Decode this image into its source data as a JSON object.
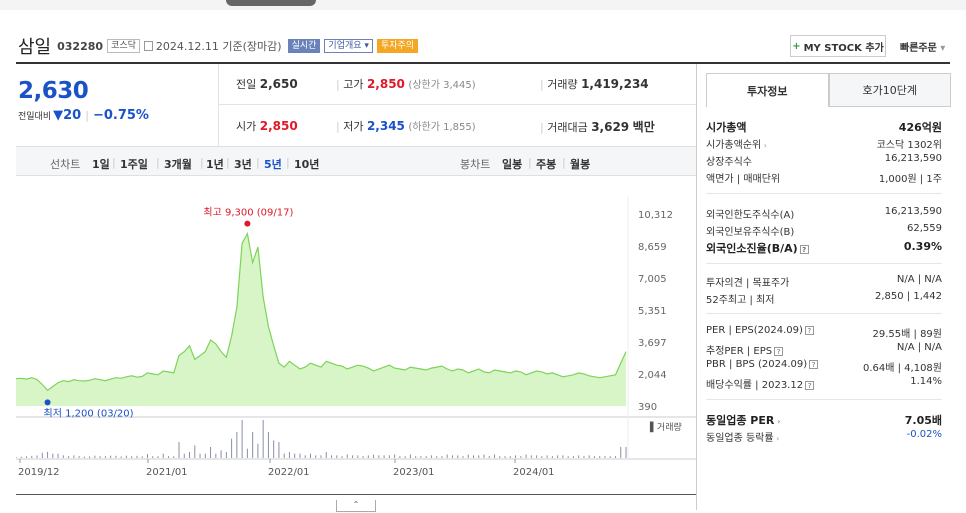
{
  "header": {
    "name": "삼일",
    "code": "032280",
    "market_tag": "코스닥",
    "date": "2024.12.11 기준(장마감)",
    "realtime_tag": "실시간",
    "company_tag": "기업개요",
    "warning_tag": "투자주의",
    "mystock_label": "MY STOCK 추가",
    "quick_order_label": "빠른주문"
  },
  "price": {
    "current": "2,630",
    "change_label": "전일대비",
    "change_arrow": "▼",
    "change_value": "20",
    "change_pct": "−0.75%"
  },
  "stats": {
    "prev_label": "전일",
    "prev": "2,650",
    "high_label": "고가",
    "high": "2,850",
    "high_limit": "(상한가 3,445)",
    "volume_label": "거래량",
    "volume": "1,419,234",
    "open_label": "시가",
    "open": "2,850",
    "low_label": "저가",
    "low": "2,345",
    "low_limit": "(하한가 1,855)",
    "amount_label": "거래대금",
    "amount": "3,629",
    "amount_unit": "백만"
  },
  "period_bar": {
    "line_label": "선차트",
    "line_options": [
      "1일",
      "1주일",
      "3개월",
      "1년",
      "3년",
      "5년",
      "10년"
    ],
    "selected": "5년",
    "candle_label": "봉차트",
    "candle_options": [
      "일봉",
      "주봉",
      "월봉"
    ]
  },
  "chart_data": {
    "type": "area",
    "y_ticks": [
      10312,
      8659,
      7005,
      5351,
      3697,
      2044,
      390
    ],
    "y_tick_labels": [
      "10,312",
      "8,659",
      "7,005",
      "5,351",
      "3,697",
      "2,044",
      "390"
    ],
    "ylim": [
      390,
      10312
    ],
    "x_tick_labels": [
      "2019/12",
      "2021/01",
      "2022/01",
      "2023/01",
      "2024/01"
    ],
    "max_label": "최고 9,300 (09/17)",
    "min_label": "최저 1,200 (03/20)",
    "volume_label": "거래량",
    "line_color": "#7dd35a",
    "fill_color": "#d8f5c8",
    "series": [
      {
        "values": [
          1800,
          1820,
          1780,
          1850,
          1760,
          1500,
          1200,
          1400,
          1600,
          1700,
          1650,
          1750,
          1700,
          1680,
          1720,
          1800,
          1750,
          1700,
          1780,
          1850,
          1820,
          1900,
          1950,
          1880,
          1920,
          2100,
          2050,
          2000,
          2200,
          2150,
          2100,
          3000,
          3200,
          3500,
          2800,
          3000,
          3200,
          3800,
          3600,
          3200,
          2900,
          4000,
          5500,
          8800,
          9300,
          7800,
          8600,
          6000,
          4500,
          3500,
          2600,
          2400,
          2700,
          2500,
          2300,
          2400,
          2600,
          2500,
          2400,
          2700,
          2600,
          2500,
          2450,
          2300,
          2400,
          2500,
          2450,
          2350,
          2200,
          2300,
          2400,
          2500,
          2350,
          2300,
          2250,
          2400,
          2350,
          2300,
          2250,
          2350,
          2400,
          2450,
          2300,
          2200,
          2300,
          2250,
          2100,
          2200,
          2300,
          2150,
          2100,
          2250,
          2200,
          2150,
          2100,
          2200,
          2150,
          2000,
          2100,
          2200,
          2150,
          2050,
          2100,
          2000,
          1900,
          1950,
          2000,
          2100,
          2050,
          1950,
          1900,
          1850,
          1900,
          1950,
          2000,
          2600,
          3200
        ]
      }
    ]
  },
  "panel": {
    "tab_info": "투자정보",
    "tab_orderbook": "호가10단계",
    "rows": [
      {
        "k": "시가총액",
        "v": "426억원"
      },
      {
        "k": "시가총액순위",
        "v": "코스닥 1302위"
      },
      {
        "k": "상장주식수",
        "v": "16,213,590"
      },
      {
        "k": "액면가 | 매매단위",
        "v": "1,000원 | 1주"
      },
      {
        "k": "외국인한도주식수(A)",
        "v": "16,213,590"
      },
      {
        "k": "외국인보유주식수(B)",
        "v": "62,559"
      },
      {
        "k": "외국인소진율(B/A)",
        "v": "0.39%"
      },
      {
        "k": "투자의견 | 목표주가",
        "v": "N/A | N/A"
      },
      {
        "k": "52주최고 | 최저",
        "v": "2,850 | 1,442"
      },
      {
        "k": "PER | EPS(2024.09)",
        "v": "29.55배 | 89원"
      },
      {
        "k": "추정PER | EPS",
        "v": "N/A | N/A"
      },
      {
        "k": "PBR | BPS (2024.09)",
        "v": "0.64배 | 4,108원"
      },
      {
        "k": "배당수익률 | 2023.12",
        "v": "1.14%"
      },
      {
        "k": "동일업종 PER",
        "v": "7.05배"
      },
      {
        "k": "동일업종 등락률",
        "v": "-0.02%"
      }
    ]
  }
}
